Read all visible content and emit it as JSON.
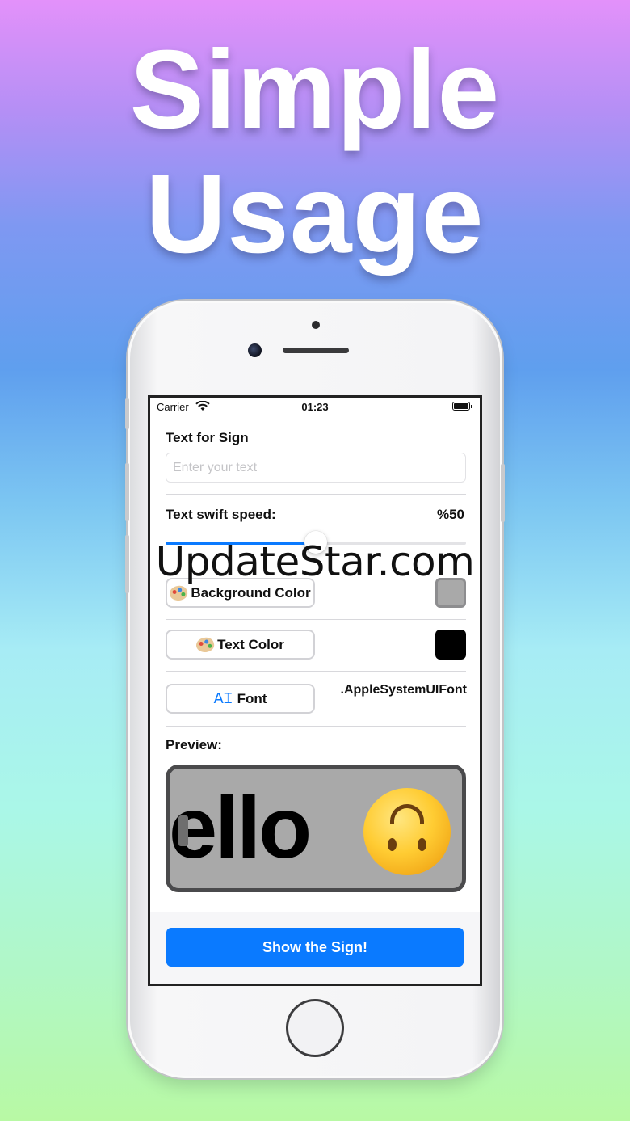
{
  "promo": {
    "headline_line1": "Simple",
    "headline_line2": "Usage"
  },
  "status_bar": {
    "carrier": "Carrier",
    "time": "01:23"
  },
  "form": {
    "text_label": "Text for Sign",
    "text_placeholder": "Enter your text",
    "speed_label": "Text swift speed:",
    "speed_value": "%50",
    "speed_fraction": 0.5,
    "background_color_button": "Background Color",
    "background_color_value": "#a9a9a9",
    "text_color_button": "Text Color",
    "text_color_value": "#000000",
    "font_button": "Font",
    "font_name": ".AppleSystemUIFont",
    "preview_label": "Preview:",
    "preview_text": "lello"
  },
  "actions": {
    "show_sign": "Show the Sign!"
  },
  "watermark": "UpdateStar.com",
  "colors": {
    "accent": "#0a7aff"
  }
}
